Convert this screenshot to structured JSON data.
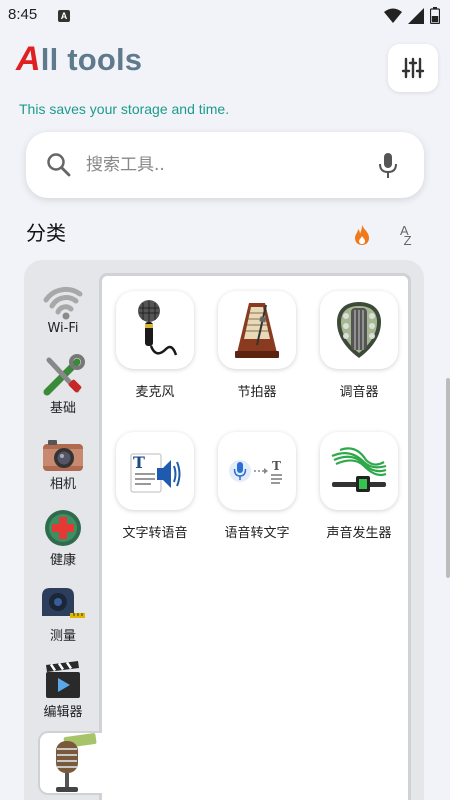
{
  "status_bar": {
    "time": "8:45",
    "notif_letter": "A"
  },
  "header": {
    "title_first": "A",
    "title_rest": "ll tools",
    "subtitle": "This saves your storage and time."
  },
  "search": {
    "placeholder": "搜索工具.."
  },
  "section": {
    "title": "分类",
    "sort_az": "A\nZ"
  },
  "categories": [
    {
      "label": "Wi-Fi",
      "icon": "wifi-icon"
    },
    {
      "label": "基础",
      "icon": "tools-icon"
    },
    {
      "label": "相机",
      "icon": "camera-icon"
    },
    {
      "label": "健康",
      "icon": "health-cross-icon"
    },
    {
      "label": "测量",
      "icon": "tape-measure-icon"
    },
    {
      "label": "编辑器",
      "icon": "clapperboard-icon"
    },
    {
      "label": "",
      "icon": "vintage-mic-icon"
    }
  ],
  "tools": [
    {
      "label": "麦克风",
      "icon": "microphone-icon"
    },
    {
      "label": "节拍器",
      "icon": "metronome-icon"
    },
    {
      "label": "调音器",
      "icon": "guitar-tuner-icon"
    },
    {
      "label": "文字转语音",
      "icon": "text-to-speech-icon"
    },
    {
      "label": "语音转文字",
      "icon": "speech-to-text-icon"
    },
    {
      "label": "声音发生器",
      "icon": "sound-generator-icon"
    }
  ],
  "colors": {
    "accent_red": "#e02020",
    "title_gray": "#5f7a8c",
    "subtitle_teal": "#1c9b8a",
    "hot_orange": "#f07a1a"
  }
}
